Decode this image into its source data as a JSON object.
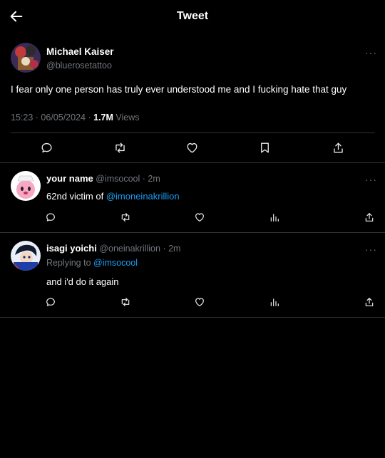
{
  "header": {
    "title": "Tweet"
  },
  "main_tweet": {
    "display_name": "Michael Kaiser",
    "handle": "@bluerosetattoo",
    "text": "I fear only one person has truly ever understood me and I fucking hate that guy",
    "time": "15:23",
    "date": "06/05/2024",
    "separator": "·",
    "views_count": "1.7M",
    "views_label": "Views",
    "more": "···"
  },
  "replies": [
    {
      "display_name": "your name",
      "handle": "@imsocool",
      "time": "· 2m",
      "text_prefix": "62nd victim of ",
      "mention": "@imoneinakrillion",
      "more": "···"
    },
    {
      "display_name": "isagi yoichi",
      "handle": "@oneinakrillion",
      "time": "· 2m",
      "replying_to_label": "Replying to ",
      "replying_to_handle": "@imsocool",
      "text": "and i'd do it again",
      "more": "···"
    }
  ],
  "colors": {
    "background": "#000000",
    "accent": "#1d9bf0",
    "muted": "#71767b",
    "divider": "#2f3336"
  }
}
